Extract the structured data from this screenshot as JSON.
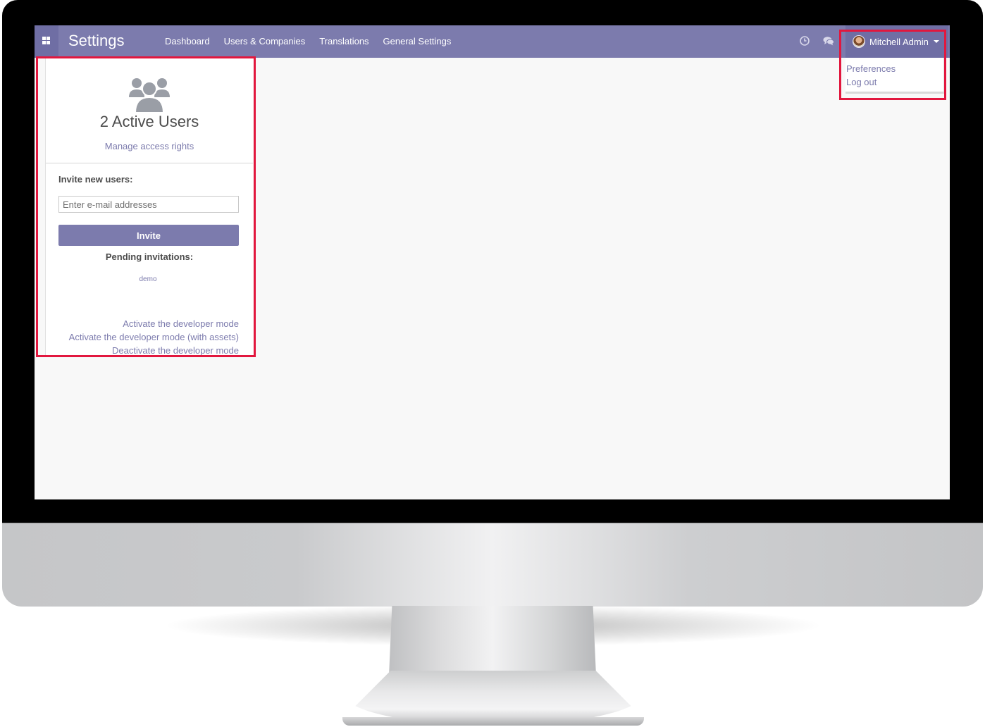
{
  "navbar": {
    "app_title": "Settings",
    "menu": [
      "Dashboard",
      "Users & Companies",
      "Translations",
      "General Settings"
    ],
    "apps_icon": "apps-grid-icon",
    "activity_icon": "clock-icon",
    "discuss_icon": "chat-bubbles-icon",
    "user": {
      "name": "Mitchell Admin",
      "avatar_icon": "user-avatar-icon",
      "caret_icon": "caret-down-icon"
    }
  },
  "user_menu": {
    "items": [
      "Preferences",
      "Log out"
    ]
  },
  "users_panel": {
    "icon": "users-group-icon",
    "active_users": "2 Active Users",
    "manage_link": "Manage access rights",
    "invite_label": "Invite new users:",
    "email_placeholder": "Enter e-mail addresses",
    "invite_button": "Invite",
    "pending_label": "Pending invitations:",
    "pending": [
      "demo"
    ],
    "developer_links": [
      "Activate the developer mode",
      "Activate the developer mode (with assets)",
      "Deactivate the developer mode"
    ]
  },
  "colors": {
    "brand": "#7c7bad",
    "highlight": "#e2173e"
  }
}
